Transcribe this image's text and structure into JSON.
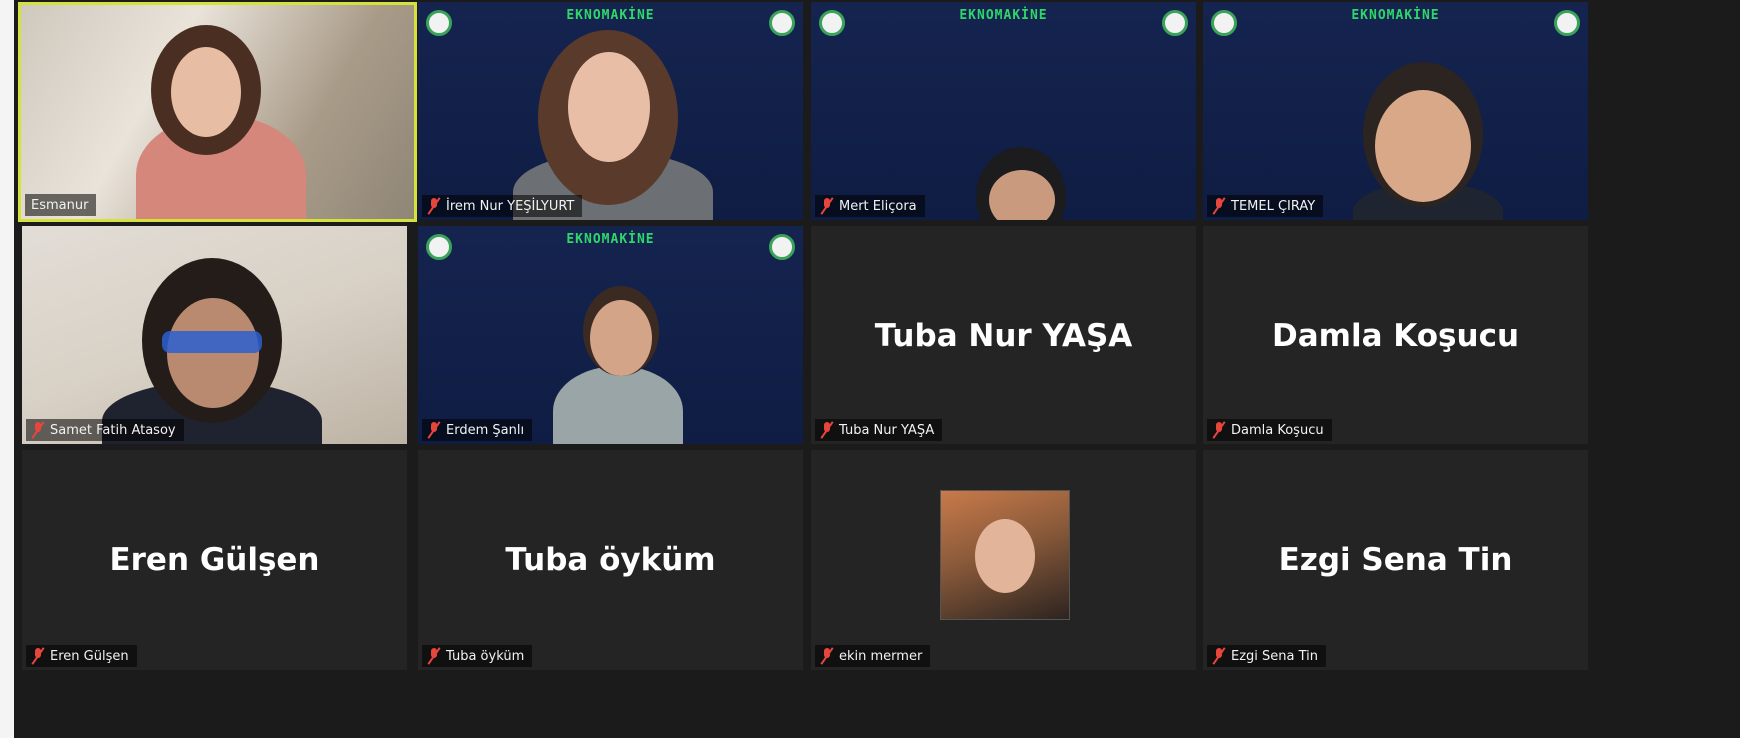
{
  "participants": [
    {
      "name": "Esmanur",
      "label": "Esmanur",
      "video": true,
      "active": true,
      "muted": false
    },
    {
      "name": "İrem Nur YEŞİLYURT",
      "label": "İrem Nur YEŞİLYURT",
      "video": true,
      "brand": "EKNOMAKİNE",
      "muted": true
    },
    {
      "name": "Mert Eliçora",
      "label": "Mert Eliçora",
      "video": true,
      "brand": "EKNOMAKİNE",
      "muted": true
    },
    {
      "name": "TEMEL ÇIRAY",
      "label": "TEMEL ÇIRAY",
      "video": true,
      "brand": "EKNOMAKİNE",
      "muted": true
    },
    {
      "name": "Samet Fatih Atasoy",
      "label": "Samet Fatih Atasoy",
      "video": true,
      "muted": true
    },
    {
      "name": "Erdem Şanlı",
      "label": "Erdem Şanlı",
      "video": true,
      "brand": "EKNOMAKİNE",
      "muted": true
    },
    {
      "name": "Tuba Nur YAŞA",
      "label": "Tuba Nur YAŞA",
      "video": false,
      "muted": true
    },
    {
      "name": "Damla Koşucu",
      "label": "Damla Koşucu",
      "video": false,
      "muted": true
    },
    {
      "name": "Eren Gülşen",
      "label": "Eren Gülşen",
      "video": false,
      "muted": true
    },
    {
      "name": "Tuba öyküm",
      "label": "Tuba öyküm",
      "video": false,
      "muted": true
    },
    {
      "name": "ekin mermer",
      "label": "ekin mermer",
      "video": false,
      "avatar": true,
      "muted": true
    },
    {
      "name": "Ezgi Sena Tin",
      "label": "Ezgi Sena Tin",
      "video": false,
      "muted": true
    }
  ],
  "colors": {
    "background": "#1b1b1b",
    "tile": "#242424",
    "active_border": "#d6e23c",
    "muted_icon": "#e8453c",
    "brand_text": "#2fd66a",
    "brand_bg": "#15244f"
  },
  "icons": {
    "muted": "mic-muted-icon",
    "logo": "emblem-logo-icon"
  }
}
